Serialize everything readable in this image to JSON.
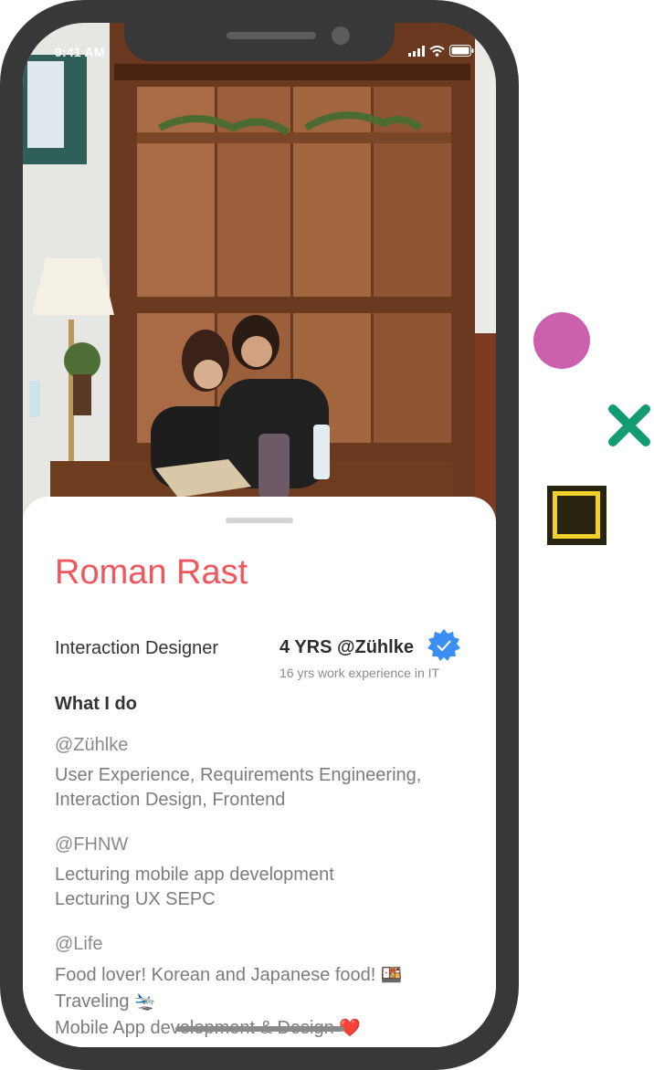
{
  "status_bar": {
    "time": "9:41 AM"
  },
  "profile": {
    "name": "Roman Rast",
    "role": "Interaction Designer",
    "experience_headline": "4 YRS @Zühlke",
    "experience_detail": "16 yrs work experience in IT"
  },
  "what_i_do": {
    "title": "What I do",
    "sections": [
      {
        "org": "@Zühlke",
        "lines": [
          "User Experience, Requirements Engineering,",
          "Interaction Design, Frontend"
        ]
      },
      {
        "org": "@FHNW",
        "lines": [
          "Lecturing mobile app development",
          "Lecturing UX SEPC"
        ]
      },
      {
        "org": "@Life",
        "lines": [
          "Food lover! Korean and Japanese food!",
          "Traveling",
          "Mobile App development & Design"
        ]
      }
    ],
    "emojis": [
      "🍱",
      "🛬",
      "❤️"
    ]
  },
  "colors": {
    "name_accent": "#f0565c",
    "badge_blue": "#3b8ff2",
    "circle_pink": "#cc5fae",
    "cross_green": "#139b73",
    "square_yellow": "#f2d12a",
    "square_dark": "#282410",
    "phone_frame": "#383838"
  },
  "icons": [
    "signal-icon",
    "wifi-icon",
    "battery-icon",
    "verified-badge-icon",
    "pink-circle-icon",
    "green-cross-icon",
    "yellow-square-icon"
  ]
}
